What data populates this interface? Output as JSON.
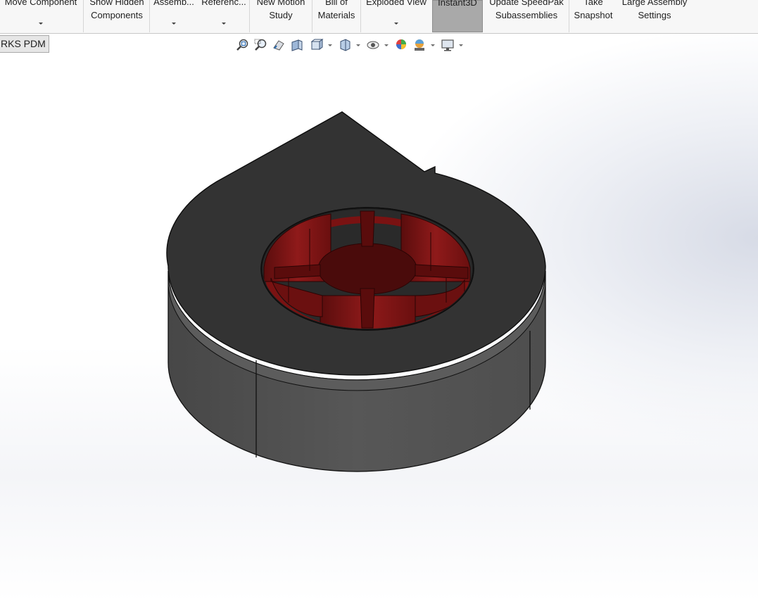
{
  "ribbon": {
    "buttons": [
      {
        "line1": "Move Component",
        "line2": "",
        "dropdown": true
      },
      {
        "line1": "Show Hidden",
        "line2": "Components",
        "dropdown": false
      },
      {
        "line1": "Assemb...",
        "line2": "",
        "dropdown": true
      },
      {
        "line1": "Referenc...",
        "line2": "",
        "dropdown": true
      },
      {
        "line1": "New Motion",
        "line2": "Study",
        "dropdown": false
      },
      {
        "line1": "Bill of",
        "line2": "Materials",
        "dropdown": false
      },
      {
        "line1": "Exploded View",
        "line2": "",
        "dropdown": true
      },
      {
        "line1": "Instant3D",
        "line2": "",
        "dropdown": false,
        "active": true
      },
      {
        "line1": "Update SpeedPak",
        "line2": "Subassemblies",
        "dropdown": false
      },
      {
        "line1": "Take",
        "line2": "Snapshot",
        "dropdown": false
      },
      {
        "line1": "Large Assembly",
        "line2": "Settings",
        "dropdown": false
      }
    ]
  },
  "tab": {
    "label": "RKS PDM"
  },
  "heads_up_toolbar": [
    "zoom-to-fit-icon",
    "zoom-to-area-icon",
    "previous-view-icon",
    "section-view-icon",
    "view-orientation-icon",
    "display-style-icon",
    "hide-show-items-icon",
    "edit-appearance-icon",
    "apply-scene-icon",
    "view-settings-icon"
  ],
  "colors": {
    "housing": "#4b4b4b",
    "housing_top": "#2f2f2f",
    "impeller": "#8a1414",
    "active_button": "#a9a9a9"
  }
}
